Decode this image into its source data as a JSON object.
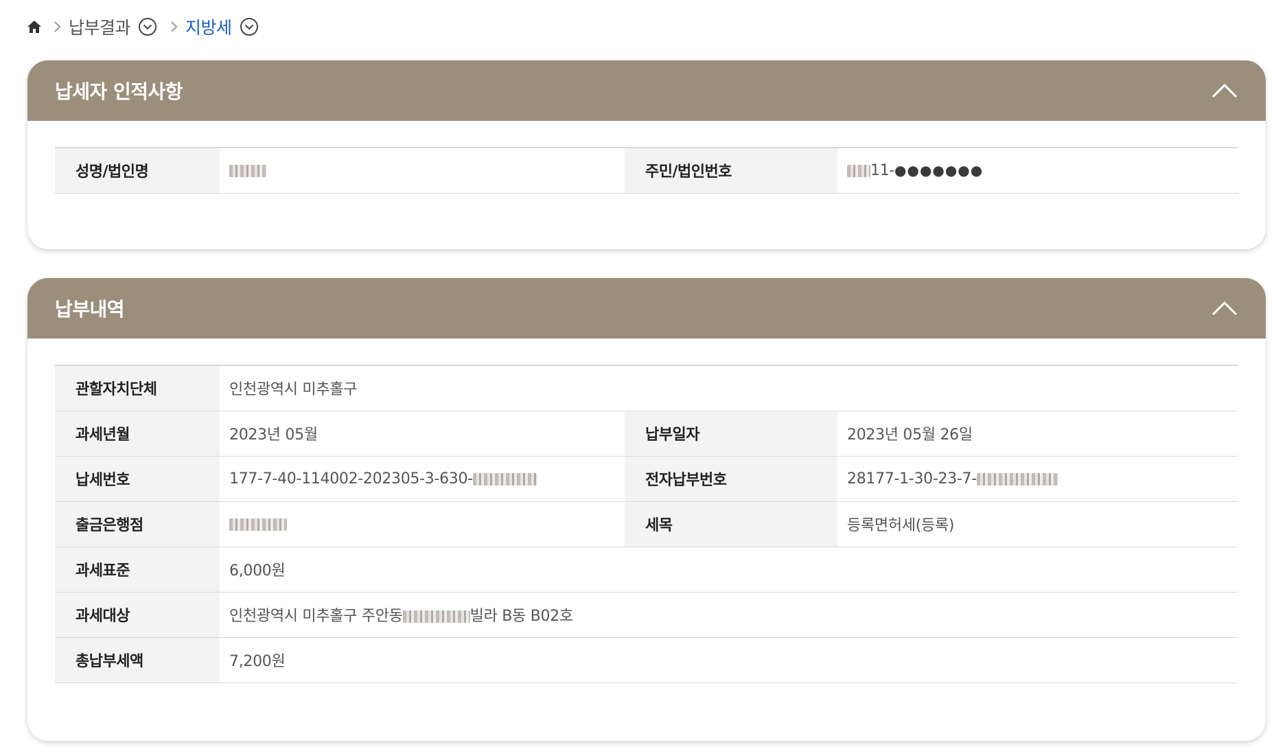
{
  "breadcrumb": {
    "items": [
      {
        "label": "납부결과"
      },
      {
        "label": "지방세"
      }
    ]
  },
  "colors": {
    "header_bg": "#9b8f7c",
    "active_crumb": "#1b5fc1"
  },
  "icons": [
    "home-icon",
    "chevron-right-icon",
    "circle-chevron-down-icon",
    "chevron-up-icon"
  ],
  "taxpayer": {
    "title": "납세자 인적사항",
    "name_label": "성명/법인명",
    "id_label": "주민/법인번호",
    "id_value": "11-",
    "id_masked": "●●●●●●●"
  },
  "payment": {
    "title": "납부내역",
    "rows": {
      "jurisdiction_label": "관할자치단체",
      "jurisdiction_value": "인천광역시 미추홀구",
      "tax_year_month_label": "과세년월",
      "tax_year_month_value": "2023년 05월",
      "payment_date_label": "납부일자",
      "payment_date_value": "2023년 05월 26일",
      "tax_number_label": "납세번호",
      "tax_number_value": "177-7-40-114002-202305-3-630-",
      "e_payment_number_label": "전자납부번호",
      "e_payment_number_value": "28177-1-30-23-7-",
      "bank_branch_label": "출금은행점",
      "tax_item_label": "세목",
      "tax_item_value": "등록면허세(등록)",
      "tax_base_label": "과세표준",
      "tax_base_value": "6,000원",
      "tax_object_label": "과세대상",
      "tax_object_value_prefix": "인천광역시 미추홀구 주안동",
      "tax_object_value_suffix": "빌라 B동 B02호",
      "total_amount_label": "총납부세액",
      "total_amount_value": "7,200원"
    }
  }
}
